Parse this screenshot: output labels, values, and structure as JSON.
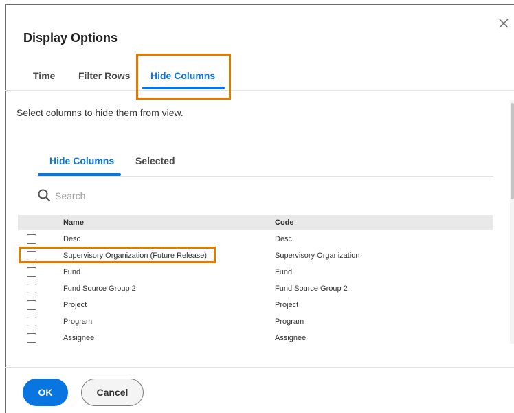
{
  "dialog": {
    "title": "Display Options",
    "close_icon": "close-icon"
  },
  "tabs": [
    {
      "label": "Time"
    },
    {
      "label": "Filter Rows"
    },
    {
      "label": "Hide Columns",
      "active": true
    }
  ],
  "instruction": "Select columns to hide them from view.",
  "subtabs": [
    {
      "label": "Hide Columns",
      "active": true
    },
    {
      "label": "Selected"
    }
  ],
  "search": {
    "placeholder": "Search",
    "value": "",
    "icon": "search-icon"
  },
  "table": {
    "headers": [
      "Name",
      "Code"
    ],
    "rows": [
      {
        "name": "Desc",
        "code": "Desc",
        "checked": false
      },
      {
        "name": "Supervisory Organization (Future Release)",
        "code": "Supervisory Organization",
        "checked": false
      },
      {
        "name": "Fund",
        "code": "Fund",
        "checked": false
      },
      {
        "name": "Fund Source Group 2",
        "code": "Fund Source Group 2",
        "checked": false
      },
      {
        "name": "Project",
        "code": "Project",
        "checked": false
      },
      {
        "name": "Program",
        "code": "Program",
        "checked": false
      },
      {
        "name": "Assignee",
        "code": "Assignee",
        "checked": false
      }
    ]
  },
  "footer": {
    "ok_label": "OK",
    "cancel_label": "Cancel"
  },
  "colors": {
    "accent": "#0875e1",
    "highlight": "#e07b00"
  }
}
